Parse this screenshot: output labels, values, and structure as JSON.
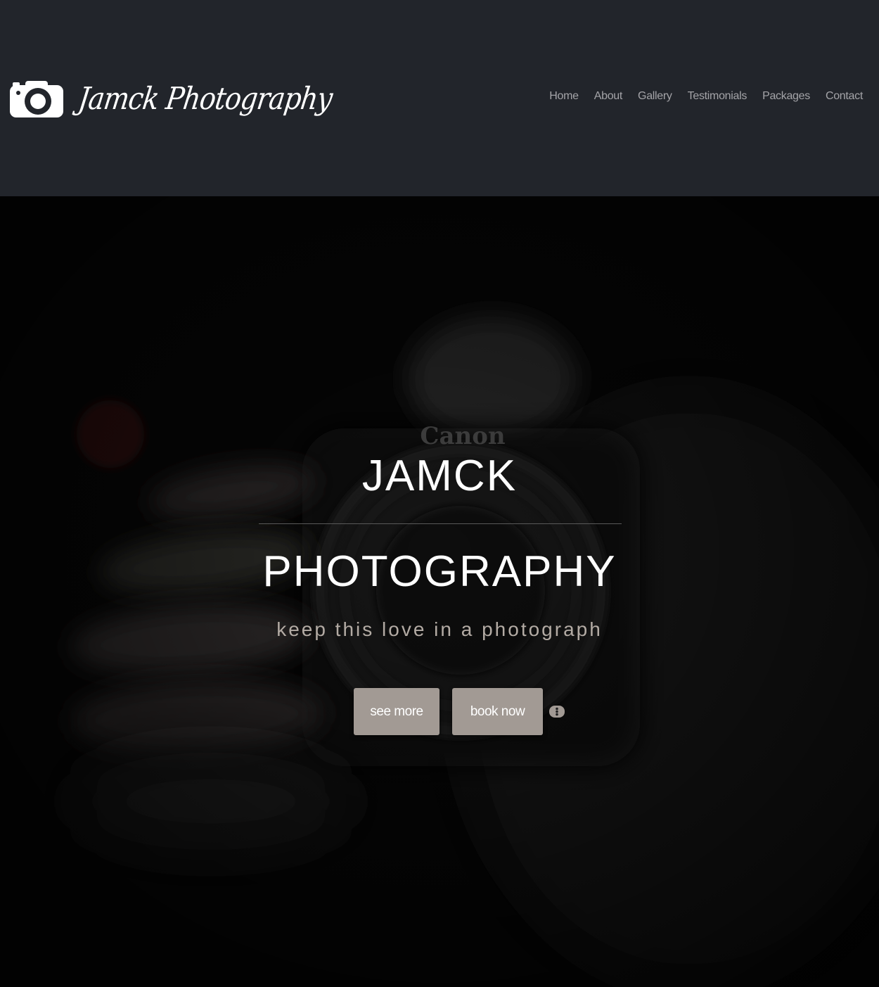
{
  "header": {
    "brand": "Jamck Photography",
    "logo_icon": "camera-icon",
    "nav": [
      {
        "label": "Home"
      },
      {
        "label": "About"
      },
      {
        "label": "Gallery"
      },
      {
        "label": "Testimonials"
      },
      {
        "label": "Packages"
      },
      {
        "label": "Contact"
      }
    ]
  },
  "hero": {
    "title_line1": "JAMCK",
    "title_line2": "PHOTOGRAPHY",
    "tagline": "keep this love in a photograph",
    "buttons": {
      "see_more": "see more",
      "book_now": "book now"
    },
    "extra_icon": "more-options-icon"
  },
  "colors": {
    "header_bg": "#22252b",
    "nav_text": "#a4a4a8",
    "button_bg": "#a29a94",
    "tagline": "#b3aba4"
  }
}
